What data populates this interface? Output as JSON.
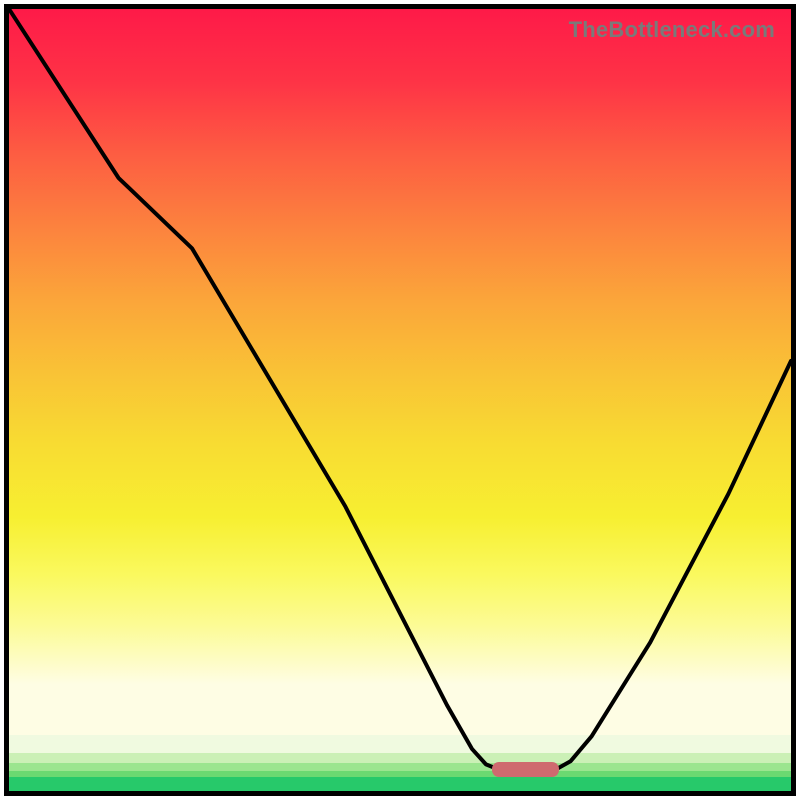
{
  "watermark": "TheBottleneck.com",
  "gradient": {
    "main_stops": [
      {
        "pos": 0.0,
        "color": "#fe1a48"
      },
      {
        "pos": 0.1,
        "color": "#fe3346"
      },
      {
        "pos": 0.2,
        "color": "#fd5d42"
      },
      {
        "pos": 0.3,
        "color": "#fc823e"
      },
      {
        "pos": 0.4,
        "color": "#fba53a"
      },
      {
        "pos": 0.5,
        "color": "#f9c236"
      },
      {
        "pos": 0.6,
        "color": "#f8dc32"
      },
      {
        "pos": 0.7,
        "color": "#f7ef31"
      },
      {
        "pos": 0.78,
        "color": "#faf95f"
      },
      {
        "pos": 0.85,
        "color": "#fcfb96"
      },
      {
        "pos": 0.93,
        "color": "#fefde4"
      }
    ],
    "tail": [
      {
        "h": 18,
        "color": "#f0fae0"
      },
      {
        "h": 10,
        "color": "#cbf0b6"
      },
      {
        "h": 8,
        "color": "#9be58f"
      },
      {
        "h": 6,
        "color": "#6bd971"
      },
      {
        "h": 14,
        "color": "#27c96a"
      }
    ]
  },
  "curve": {
    "points": [
      {
        "x": 0.0,
        "y": 0.0
      },
      {
        "x": 0.14,
        "y": 0.216
      },
      {
        "x": 0.234,
        "y": 0.306
      },
      {
        "x": 0.43,
        "y": 0.636
      },
      {
        "x": 0.56,
        "y": 0.89
      },
      {
        "x": 0.592,
        "y": 0.946
      },
      {
        "x": 0.61,
        "y": 0.966
      },
      {
        "x": 0.625,
        "y": 0.972
      },
      {
        "x": 0.7,
        "y": 0.972
      },
      {
        "x": 0.718,
        "y": 0.962
      },
      {
        "x": 0.745,
        "y": 0.93
      },
      {
        "x": 0.82,
        "y": 0.81
      },
      {
        "x": 0.92,
        "y": 0.62
      },
      {
        "x": 1.0,
        "y": 0.45
      }
    ],
    "stroke": "#000000",
    "stroke_width": 4
  },
  "valley_marker": {
    "x_frac": 0.617,
    "width_frac": 0.086,
    "y_frac": 0.972,
    "color": "#cf6a6f"
  },
  "chart_data": {
    "type": "line",
    "title": "",
    "xlabel": "",
    "ylabel": "",
    "xlim": [
      0,
      1
    ],
    "ylim": [
      0,
      1
    ],
    "series": [
      {
        "name": "bottleneck-curve",
        "x": [
          0.0,
          0.14,
          0.234,
          0.43,
          0.56,
          0.592,
          0.61,
          0.625,
          0.7,
          0.718,
          0.745,
          0.82,
          0.92,
          1.0
        ],
        "y": [
          1.0,
          0.784,
          0.694,
          0.364,
          0.11,
          0.054,
          0.034,
          0.028,
          0.028,
          0.038,
          0.07,
          0.19,
          0.38,
          0.55
        ]
      }
    ],
    "annotations": [
      {
        "type": "optimal-range",
        "x_start": 0.617,
        "x_end": 0.703
      }
    ],
    "background": "vertical-gradient red→orange→yellow→pale→green",
    "grid": false
  }
}
